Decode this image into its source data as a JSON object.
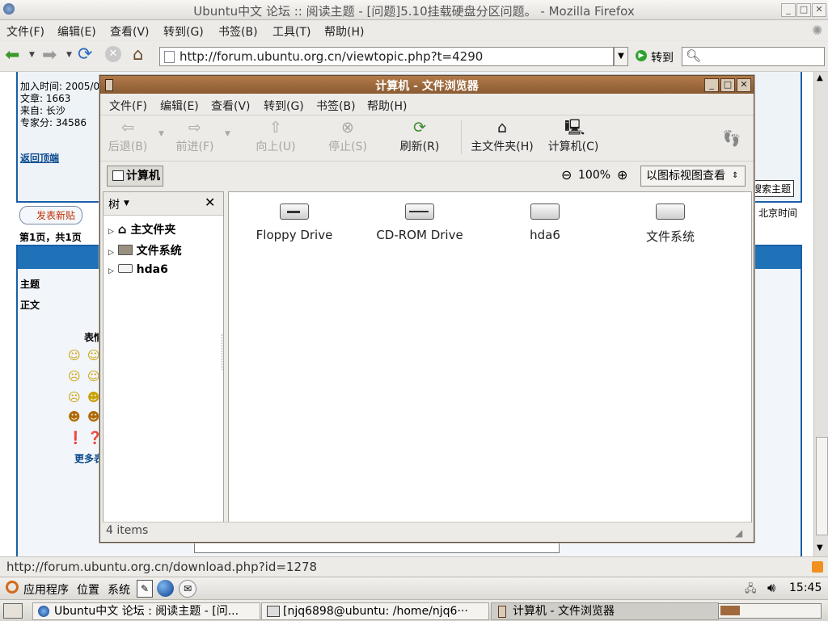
{
  "firefox": {
    "title": "Ubuntu中文 论坛 :: 阅读主题 - [问题]5.10挂载硬盘分区问题。 - Mozilla Firefox",
    "menu": [
      "文件(F)",
      "编辑(E)",
      "查看(V)",
      "转到(G)",
      "书签(B)",
      "工具(T)",
      "帮助(H)"
    ],
    "url": "http://forum.ubuntu.org.cn/viewtopic.php?t=4290",
    "go_label": "转到",
    "status_url": "http://forum.ubuntu.org.cn/download.php?id=1278"
  },
  "forum": {
    "joined": "加入时间: 2005/0",
    "posts": "文章: 1663",
    "from": "来自: 长沙",
    "expert": "专家分: 34586",
    "back_to_top": "返回顶端",
    "search_topic": "搜索主题",
    "new_post": "发表新贴",
    "page_info": "第1页，共1页",
    "timezone": "北京时间",
    "subject_label": "主题",
    "body_label": "正文",
    "smilies_label": "表情",
    "more_smilies": "更多表"
  },
  "nautilus": {
    "title": "计算机 - 文件浏览器",
    "menu": [
      "文件(F)",
      "编辑(E)",
      "查看(V)",
      "转到(G)",
      "书签(B)",
      "帮助(H)"
    ],
    "toolbar": {
      "back": "后退(B)",
      "forward": "前进(F)",
      "up": "向上(U)",
      "stop": "停止(S)",
      "reload": "刷新(R)",
      "home": "主文件夹(H)",
      "computer": "计算机(C)"
    },
    "location": "计算机",
    "zoom": "100%",
    "view_mode": "以图标视图查看",
    "side_pane": "树",
    "tree": [
      "主文件夹",
      "文件系统",
      "hda6"
    ],
    "items": [
      "Floppy Drive",
      "CD-ROM Drive",
      "hda6",
      "文件系统"
    ],
    "status": "4 items"
  },
  "panel": {
    "apps": "应用程序",
    "places": "位置",
    "system": "系统",
    "clock": "15:45"
  },
  "tasks": [
    "Ubuntu中文 论坛 : 阅读主题 - [问...",
    "[njq6898@ubuntu: /home/njq6···",
    "计算机 - 文件浏览器"
  ]
}
